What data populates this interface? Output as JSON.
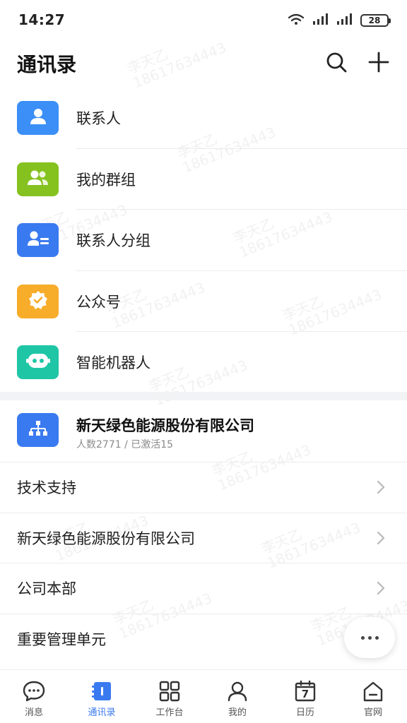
{
  "status_bar": {
    "time": "14:27",
    "battery": "28"
  },
  "header": {
    "title": "通讯录"
  },
  "menu": [
    {
      "label": "联系人",
      "color": "#3b8ff6",
      "icon": "person-icon"
    },
    {
      "label": "我的群组",
      "color": "#85c21f",
      "icon": "group-icon"
    },
    {
      "label": "联系人分组",
      "color": "#3a7af0",
      "icon": "contact-group-icon"
    },
    {
      "label": "公众号",
      "color": "#f7ac2a",
      "icon": "badge-check-icon"
    },
    {
      "label": "智能机器人",
      "color": "#1fc6a6",
      "icon": "robot-icon"
    }
  ],
  "org": {
    "name": "新天绿色能源股份有限公司",
    "stats": "人数2771 / 已激活15"
  },
  "departments": [
    {
      "label": "技术支持"
    },
    {
      "label": "新天绿色能源股份有限公司"
    },
    {
      "label": "公司本部"
    },
    {
      "label": "重要管理单元"
    }
  ],
  "tabs": [
    {
      "label": "消息",
      "icon": "chat-icon"
    },
    {
      "label": "通讯录",
      "icon": "contacts-icon",
      "active": true
    },
    {
      "label": "工作台",
      "icon": "grid-icon"
    },
    {
      "label": "我的",
      "icon": "profile-icon"
    },
    {
      "label": "日历",
      "icon": "calendar-icon",
      "day": "7"
    },
    {
      "label": "官网",
      "icon": "home-icon"
    }
  ],
  "watermark": {
    "name": "李天乙",
    "phone": "18617634443"
  },
  "colors": {
    "accent": "#3a7af0",
    "divider": "#ececec",
    "section_bg": "#f2f3f5"
  }
}
